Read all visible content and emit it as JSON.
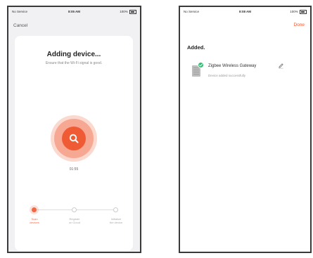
{
  "left_screen": {
    "status_bar": {
      "carrier": "No Service",
      "time": "8:05 AM",
      "battery": "100%"
    },
    "cancel_label": "Cancel",
    "title": "Adding device...",
    "subtitle": "Ensure that the Wi-Fi signal is good.",
    "timer": "01:55",
    "steps": [
      {
        "label_line1": "Scan",
        "label_line2": "devices",
        "active": true
      },
      {
        "label_line1": "Register",
        "label_line2": "on Cloud",
        "active": false
      },
      {
        "label_line1": "Initialize",
        "label_line2": "the device",
        "active": false
      }
    ],
    "accent_color": "#ef5b34"
  },
  "right_screen": {
    "status_bar": {
      "carrier": "No Service",
      "time": "8:08 AM",
      "battery": "100%"
    },
    "done_label": "Done",
    "section_title": "Added.",
    "device": {
      "name": "Zigbee Wireless Gateway",
      "status": "Device added successfully",
      "icon": "gateway-device-icon",
      "badge": "check-icon",
      "badge_color": "#2fbf71"
    }
  }
}
